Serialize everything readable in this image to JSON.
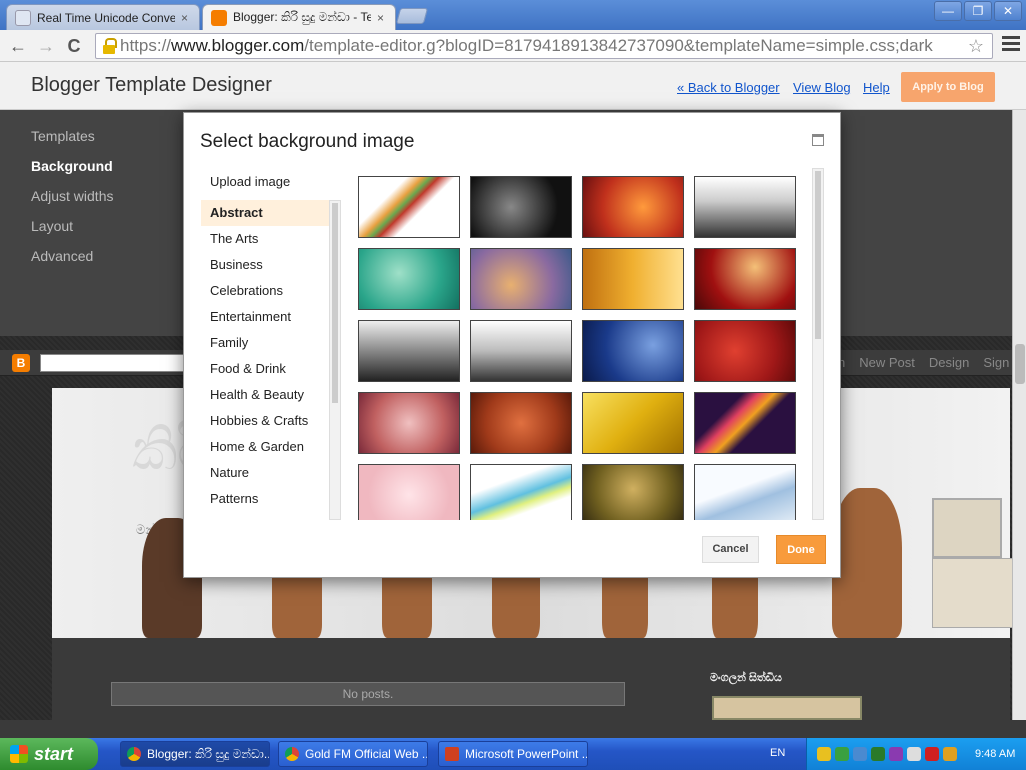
{
  "browser": {
    "tabs": [
      {
        "label": "Real Time Unicode Converte",
        "close": "×",
        "favicon_color": "#dfe6f2"
      },
      {
        "label": "Blogger: කිරි සුදු මන්ඩා - Ter",
        "close": "×",
        "favicon_color": "#f57d00"
      }
    ],
    "window_buttons": {
      "minimize": "—",
      "maximize": "❐",
      "close": "✕"
    },
    "nav": {
      "back": "←",
      "forward": "→",
      "reload": "C"
    },
    "url": {
      "scheme": "https://",
      "host": "www.blogger.com",
      "path": "/template-editor.g?blogID=8179418913842737090&templateName=simple.css;dark"
    },
    "star": "☆"
  },
  "designer": {
    "title": "Blogger Template Designer",
    "links": {
      "back": "« Back to Blogger",
      "view": "View Blog",
      "help": "Help"
    },
    "apply_label": "Apply to Blog",
    "leftnav": [
      "Templates",
      "Background",
      "Adjust widths",
      "Layout",
      "Advanced"
    ],
    "selected_nav": "Background"
  },
  "preview": {
    "blogger_logo": "B",
    "bar_links": [
      "n",
      "New Post",
      "Design",
      "Sign"
    ],
    "blog_title": "කිරි",
    "blog_subtitle": "මන්ඩාගේ කා",
    "no_posts": "No posts.",
    "sidebar_title": "මංගලන් සිත්ඩිය"
  },
  "modal": {
    "title": "Select background image",
    "upload_label": "Upload image",
    "categories": [
      "Abstract",
      "The Arts",
      "Business",
      "Celebrations",
      "Entertainment",
      "Family",
      "Food & Drink",
      "Health & Beauty",
      "Hobbies & Crafts",
      "Home & Garden",
      "Nature",
      "Patterns"
    ],
    "selected_category": "Abstract",
    "thumbnails": [
      "linear-gradient(135deg,#fff 30%,#e8a040 40%,#6aa84f 45%,#c0392b 50%,#fff 60%)",
      "radial-gradient(circle at 40% 50%,#888,#111 70%)",
      "radial-gradient(circle at 60% 50%,#ff9a3c,#c0301c 60%,#6a1010)",
      "linear-gradient(180deg,#fff,#ccc 40%,#333)",
      "radial-gradient(circle at 40% 40%,#9fe0c8,#2aa58a 60%,#137060)",
      "radial-gradient(circle at 40% 60%,#e8b070,#8a6aa0 60%,#3c5a8a)",
      "linear-gradient(90deg,#c07010,#f0b030 50%,#ffe090)",
      "radial-gradient(circle at 60% 30%,#f4c078,#a01010 60%,#4a0808)",
      "linear-gradient(180deg,#eee,#888 50%,#222)",
      "linear-gradient(180deg,#fff,#bbb 50%,#333)",
      "radial-gradient(circle at 70% 40%,#7aa0e0,#1a3a8a 60%,#0a1a4a)",
      "radial-gradient(circle at 40% 50%,#e04030,#a01818 60%,#600a0a)",
      "radial-gradient(circle at 50% 50%,#f0c0c0,#c06060 60%,#7a2a3a)",
      "radial-gradient(circle at 50% 50%,#e07040,#a03a1a 60%,#5a1a0a)",
      "linear-gradient(135deg,#f8e060,#e0b010 50%,#a07000)",
      "linear-gradient(135deg,#2a1040 30%,#e04060 40%,#f0a020 50%,#2a1040 60%)",
      "radial-gradient(circle at 50% 50%,#ffe4e8,#f0b8c0 70%)",
      "linear-gradient(160deg,#fff 30%,#60c0e0 50%,#e0f080 60%,#fff 70%)",
      "radial-gradient(circle at 50% 40%,#d0b060,#706020 60%,#302810)",
      "linear-gradient(160deg,#f8fbff 40%,#a0c0e0 60%,#e8f0f8)"
    ],
    "cancel_label": "Cancel",
    "done_label": "Done"
  },
  "taskbar": {
    "start_label": "start",
    "items": [
      {
        "label": "Blogger: කිරි සුදු මන්ඩා...",
        "icon_color": "#e8c020"
      },
      {
        "label": "Gold FM Official Web ...",
        "icon_color": "#e8c020"
      },
      {
        "label": "Microsoft PowerPoint ...",
        "icon_color": "#d04020"
      }
    ],
    "lang": "EN",
    "clock": "9:48 AM"
  }
}
